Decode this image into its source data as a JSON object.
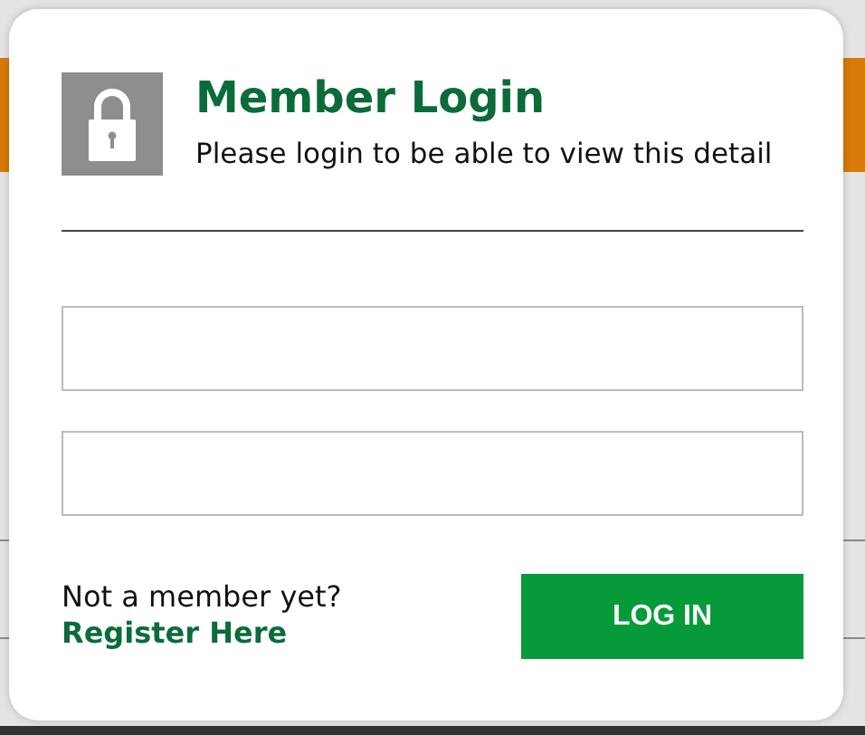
{
  "dialog": {
    "title": "Member Login",
    "subtitle": "Please login to be able to view this detail",
    "fields": [
      {
        "kind": "input"
      },
      {
        "kind": "input"
      }
    ],
    "prompt": "Not a member yet?",
    "register_link": "Register Here",
    "login_button": "LOG IN"
  }
}
